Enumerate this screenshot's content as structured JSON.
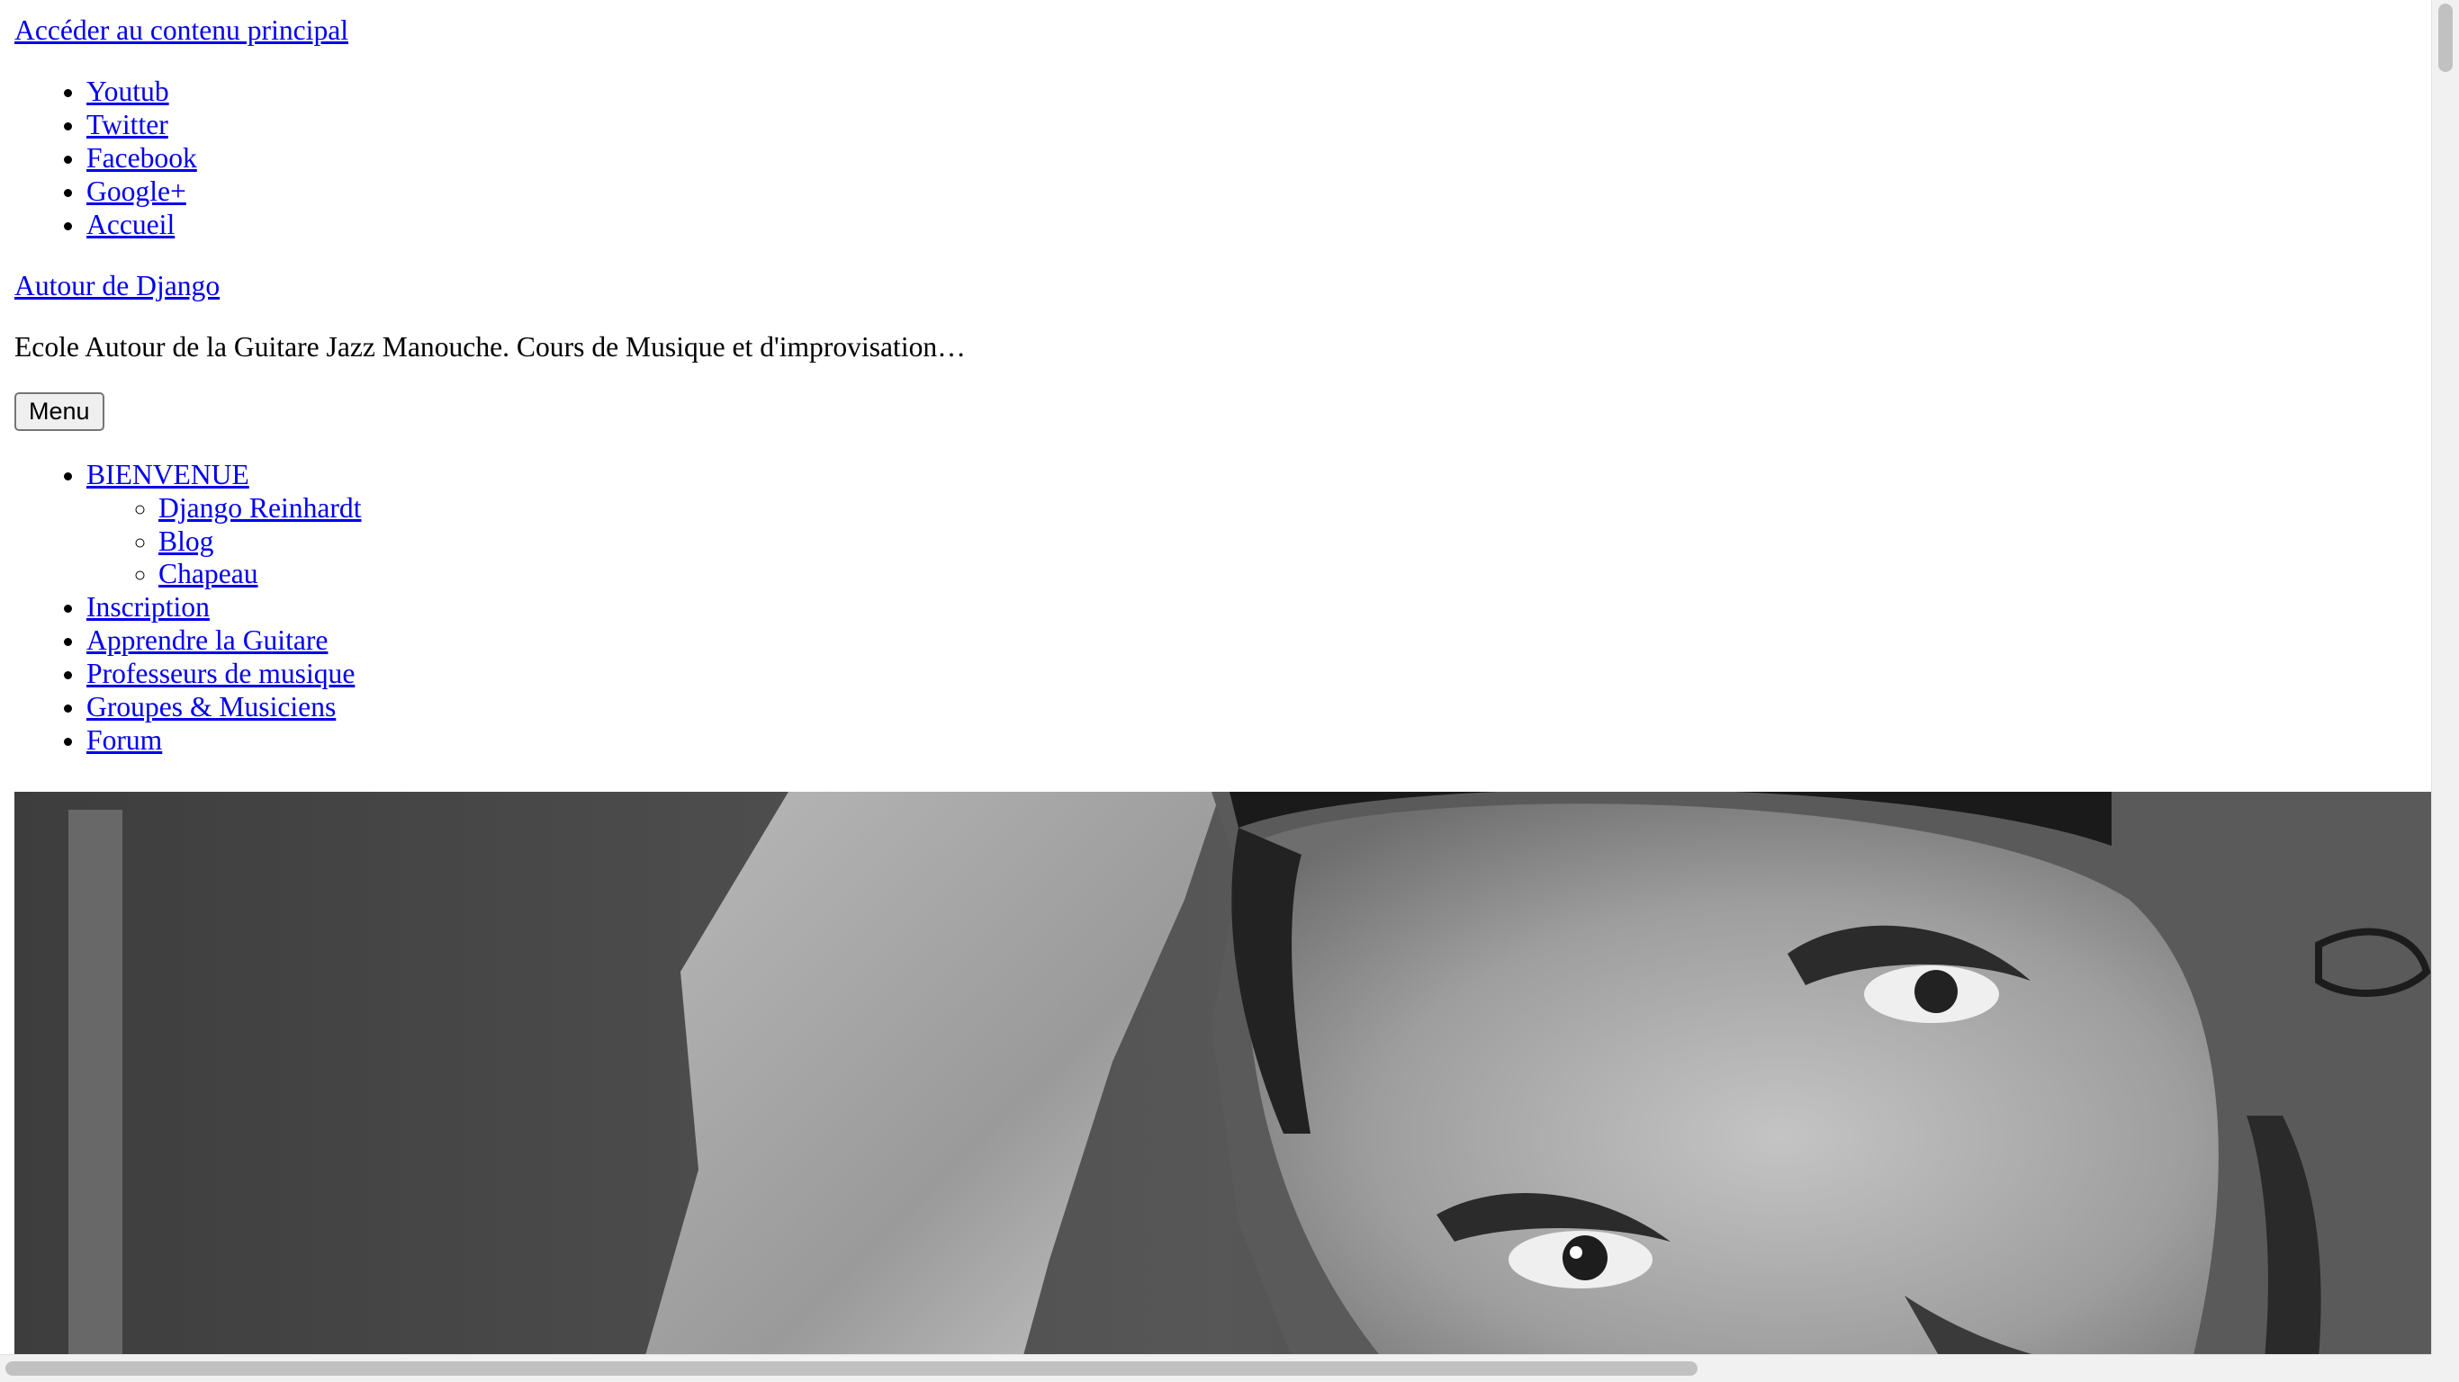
{
  "skip_link": "Accéder au contenu principal",
  "social_links": [
    "Youtub",
    "Twitter",
    "Facebook",
    "Google+",
    "Accueil"
  ],
  "site": {
    "title": "Autour de Django",
    "description": "Ecole Autour de la Guitare Jazz Manouche. Cours de Musique et d'improvisation…"
  },
  "menu_button": "Menu",
  "nav": {
    "bienvenue": {
      "label": "BIENVENUE",
      "children": [
        "Django Reinhardt",
        "Blog",
        "Chapeau"
      ]
    },
    "items": [
      "Inscription",
      "Apprendre la Guitare",
      "Professeurs de musique",
      "Groupes & Musiciens",
      "Forum"
    ]
  },
  "hero_image": {
    "subject": "black-and-white portrait photograph",
    "tone": "grayscale"
  },
  "colors": {
    "link": "#0000ee",
    "text": "#000000",
    "background": "#ffffff"
  }
}
